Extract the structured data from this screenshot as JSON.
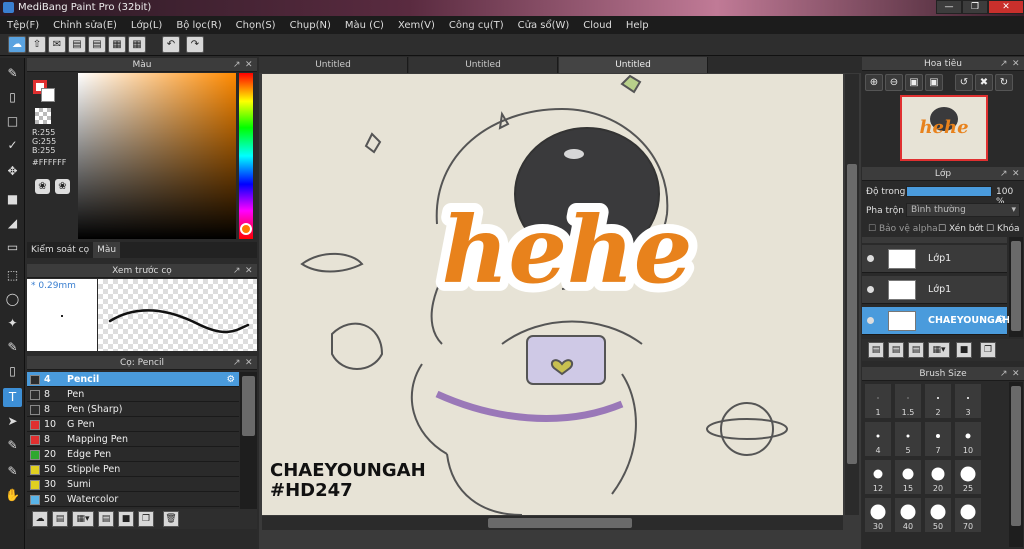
{
  "window": {
    "title": "MediBang Paint Pro (32bit)"
  },
  "menu": [
    "Tệp(F)",
    "Chỉnh sửa(E)",
    "Lớp(L)",
    "Bộ lọc(R)",
    "Chọn(S)",
    "Chụp(N)",
    "Màu (C)",
    "Xem(V)",
    "Công cụ(T)",
    "Cửa sổ(W)",
    "Cloud",
    "Help"
  ],
  "color_panel": {
    "title": "Màu",
    "rgb": [
      "R:255",
      "G:255",
      "B:255"
    ],
    "hex": "#FFFFFF",
    "tabs": [
      "Kiểm soát cọ",
      "Màu"
    ],
    "primary": "#e03030",
    "picked": "#ff8a00"
  },
  "preview_panel": {
    "title": "Xem trước cọ",
    "size": "0.29mm"
  },
  "brush_panel": {
    "title": "Cọ: Pencil",
    "items": [
      {
        "size": "4",
        "name": "Pencil",
        "color": "#2c2c2c",
        "selected": true
      },
      {
        "size": "8",
        "name": "Pen",
        "color": "#2c2c2c"
      },
      {
        "size": "8",
        "name": "Pen (Sharp)",
        "color": "#2c2c2c"
      },
      {
        "size": "10",
        "name": "G Pen",
        "color": "#e03030"
      },
      {
        "size": "8",
        "name": "Mapping Pen",
        "color": "#e03030"
      },
      {
        "size": "20",
        "name": "Edge Pen",
        "color": "#2ea82e"
      },
      {
        "size": "50",
        "name": "Stipple Pen",
        "color": "#e0d020"
      },
      {
        "size": "30",
        "name": "Sumi",
        "color": "#e0d020"
      },
      {
        "size": "50",
        "name": "Watercolor",
        "color": "#5ab4e8"
      }
    ]
  },
  "doc_tabs": [
    "Untitled",
    "Untitled",
    "Untitled"
  ],
  "canvas": {
    "title_text": "hehe",
    "credit_line1": "CHAEYOUNGAH",
    "credit_line2": "#HD247"
  },
  "navigator": {
    "title": "Hoa tiêu"
  },
  "layers": {
    "title": "Lớp",
    "opacity_label": "Độ trong",
    "opacity_value": "100 %",
    "blend_label": "Pha trộn",
    "blend_value": "Bình thường",
    "checks": [
      "Bảo vệ alpha",
      "Xén bớt",
      "Khóa"
    ],
    "items": [
      {
        "name": "Lớp1",
        "selected": false
      },
      {
        "name": "Lớp1",
        "selected": false
      },
      {
        "name": "CHAEYOUNGAH",
        "selected": true
      }
    ]
  },
  "brush_size": {
    "title": "Brush Size",
    "sizes": [
      "1",
      "1.5",
      "2",
      "3",
      "4",
      "5",
      "7",
      "10",
      "12",
      "15",
      "20",
      "25",
      "30",
      "40",
      "50",
      "70"
    ]
  }
}
